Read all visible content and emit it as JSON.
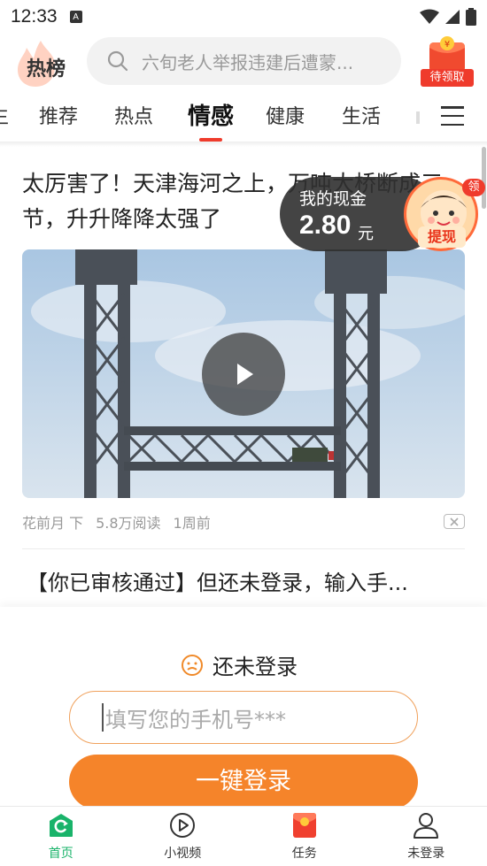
{
  "status_bar": {
    "time": "12:33",
    "notification_icon": "A"
  },
  "header": {
    "logo_text": "热榜",
    "search_placeholder": "六旬老人举报违建后遭蒙...",
    "gift_label": "待领取"
  },
  "tabs": {
    "items": [
      {
        "label": "生"
      },
      {
        "label": "推荐"
      },
      {
        "label": "热点"
      },
      {
        "label": "情感"
      },
      {
        "label": "健康"
      },
      {
        "label": "生活"
      }
    ],
    "active_index": 3
  },
  "article": {
    "title": "太厉害了！天津海河之上，万吨大桥断成三节，升升降降太强了",
    "author": "花前月 下",
    "reads": "5.8万阅读",
    "time": "1周前"
  },
  "article2": {
    "title": "【你已审核通过】但还未登录，输入手..."
  },
  "cash_float": {
    "label": "我的现金",
    "amount": "2.80",
    "unit": "元",
    "withdraw_label": "提现",
    "badge": "领"
  },
  "login": {
    "title": "还未登录",
    "phone_placeholder": "填写您的手机号***",
    "button_label": "一键登录"
  },
  "bottom_nav": {
    "items": [
      {
        "label": "首页"
      },
      {
        "label": "小视频"
      },
      {
        "label": "任务"
      },
      {
        "label": "未登录"
      }
    ],
    "active_index": 0,
    "accent_color": "#19b36a"
  },
  "colors": {
    "accent_red": "#ef3b2c",
    "login_orange": "#f5842a"
  }
}
